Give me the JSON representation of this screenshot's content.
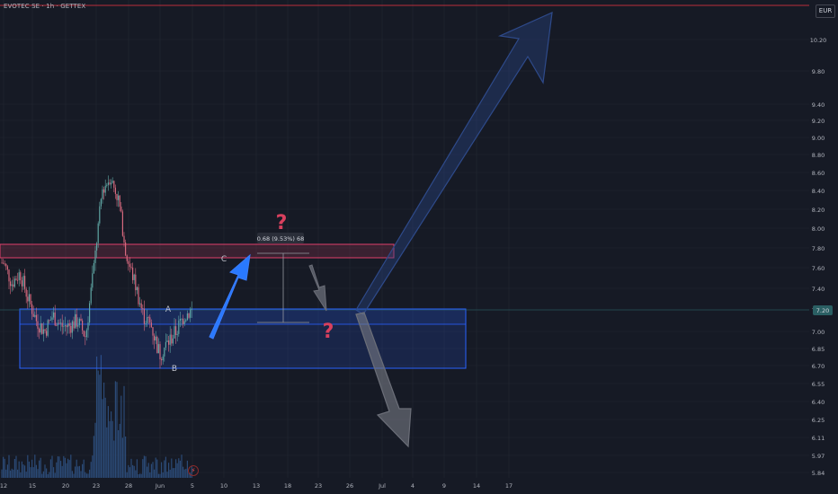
{
  "header": {
    "title": "EVOTEC SE · 1h · GETTEX"
  },
  "currency": {
    "label": "EUR"
  },
  "price_axis": {
    "ticks": [
      "10.20",
      "9.80",
      "9.40",
      "9.20",
      "9.00",
      "8.80",
      "8.60",
      "8.40",
      "8.20",
      "8.00",
      "7.80",
      "7.60",
      "7.40",
      "7.20",
      "7.00",
      "6.85",
      "6.70",
      "6.55",
      "6.40",
      "6.25",
      "6.11",
      "5.97",
      "5.84"
    ],
    "current": "7.20"
  },
  "time_axis": {
    "ticks": [
      "12",
      "15",
      "20",
      "23",
      "28",
      "Jun",
      "5",
      "10",
      "13",
      "18",
      "23",
      "26",
      "Jul",
      "4",
      "9",
      "14",
      "17"
    ]
  },
  "annotations": {
    "measure_label": "0.68 (9.53%) 68",
    "question_mark": "?",
    "wave_a": "A",
    "wave_b": "B",
    "wave_c": "C"
  },
  "colors": {
    "background": "#161a25",
    "grid": "#232733",
    "candle_up": "#5fa6a4",
    "candle_down": "#d7697e",
    "volume": "#2b4a76",
    "support_zone": "#2962ff",
    "resistance_zone": "#e0406a",
    "question": "#e0405e",
    "arrow_blue": "#2979ff",
    "arrow_grey": "#787b86",
    "target_line": "#f23645",
    "price_tag": "#2a5f63"
  },
  "chart_data": {
    "type": "candlestick",
    "symbol": "EVOTEC SE",
    "interval": "1h",
    "exchange": "GETTEX",
    "currency": "EUR",
    "ylim": [
      5.84,
      10.3
    ],
    "last_price": 7.2,
    "x": [
      "12",
      "15",
      "20",
      "23",
      "28",
      "Jun",
      "5",
      "10",
      "13",
      "18",
      "23",
      "26",
      "Jul",
      "4",
      "9",
      "14",
      "17"
    ],
    "close_path": [
      [
        "12",
        7.65
      ],
      [
        "12",
        7.45
      ],
      [
        "12",
        7.55
      ],
      [
        "15",
        7.3
      ],
      [
        "15",
        7.1
      ],
      [
        "15",
        7.0
      ],
      [
        "20",
        7.15
      ],
      [
        "20",
        7.05
      ],
      [
        "20",
        7.05
      ],
      [
        "23",
        7.1
      ],
      [
        "23",
        6.95
      ],
      [
        "23",
        7.6
      ],
      [
        "23",
        8.4
      ],
      [
        "23",
        8.55
      ],
      [
        "23",
        8.3
      ],
      [
        "28",
        7.7
      ],
      [
        "28",
        7.45
      ],
      [
        "28",
        7.15
      ],
      [
        "28",
        7.05
      ],
      [
        "28",
        6.8
      ],
      [
        "Jun",
        6.9
      ],
      [
        "Jun",
        7.0
      ],
      [
        "Jun",
        7.15
      ],
      [
        "5",
        7.2
      ]
    ],
    "zones": [
      {
        "name": "resistance",
        "from": 7.76,
        "to": 7.88
      },
      {
        "name": "support",
        "from": 6.7,
        "to": 7.2
      }
    ],
    "waves": [
      {
        "label": "A",
        "x": "Jun",
        "y": 7.2
      },
      {
        "label": "B",
        "x": "Jun",
        "y": 6.7
      },
      {
        "label": "C",
        "x": "10",
        "y": 7.7
      }
    ],
    "target_line": 10.27,
    "grid": true
  }
}
